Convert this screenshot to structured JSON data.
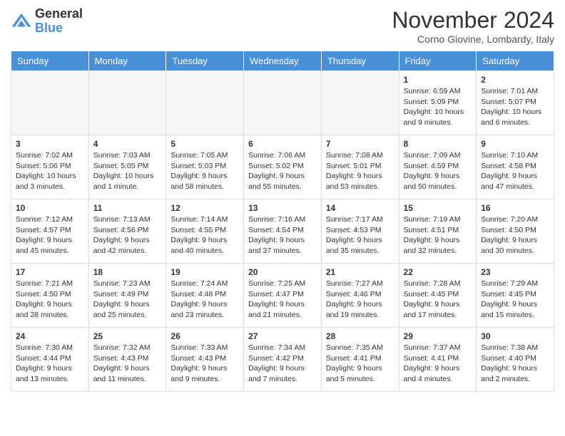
{
  "header": {
    "logo_general": "General",
    "logo_blue": "Blue",
    "month_title": "November 2024",
    "location": "Corno Giovine, Lombardy, Italy"
  },
  "days_of_week": [
    "Sunday",
    "Monday",
    "Tuesday",
    "Wednesday",
    "Thursday",
    "Friday",
    "Saturday"
  ],
  "weeks": [
    [
      {
        "day": "",
        "empty": true
      },
      {
        "day": "",
        "empty": true
      },
      {
        "day": "",
        "empty": true
      },
      {
        "day": "",
        "empty": true
      },
      {
        "day": "",
        "empty": true
      },
      {
        "day": "1",
        "sunrise": "Sunrise: 6:59 AM",
        "sunset": "Sunset: 5:09 PM",
        "daylight": "Daylight: 10 hours and 9 minutes."
      },
      {
        "day": "2",
        "sunrise": "Sunrise: 7:01 AM",
        "sunset": "Sunset: 5:07 PM",
        "daylight": "Daylight: 10 hours and 6 minutes."
      }
    ],
    [
      {
        "day": "3",
        "sunrise": "Sunrise: 7:02 AM",
        "sunset": "Sunset: 5:06 PM",
        "daylight": "Daylight: 10 hours and 3 minutes."
      },
      {
        "day": "4",
        "sunrise": "Sunrise: 7:03 AM",
        "sunset": "Sunset: 5:05 PM",
        "daylight": "Daylight: 10 hours and 1 minute."
      },
      {
        "day": "5",
        "sunrise": "Sunrise: 7:05 AM",
        "sunset": "Sunset: 5:03 PM",
        "daylight": "Daylight: 9 hours and 58 minutes."
      },
      {
        "day": "6",
        "sunrise": "Sunrise: 7:06 AM",
        "sunset": "Sunset: 5:02 PM",
        "daylight": "Daylight: 9 hours and 55 minutes."
      },
      {
        "day": "7",
        "sunrise": "Sunrise: 7:08 AM",
        "sunset": "Sunset: 5:01 PM",
        "daylight": "Daylight: 9 hours and 53 minutes."
      },
      {
        "day": "8",
        "sunrise": "Sunrise: 7:09 AM",
        "sunset": "Sunset: 4:59 PM",
        "daylight": "Daylight: 9 hours and 50 minutes."
      },
      {
        "day": "9",
        "sunrise": "Sunrise: 7:10 AM",
        "sunset": "Sunset: 4:58 PM",
        "daylight": "Daylight: 9 hours and 47 minutes."
      }
    ],
    [
      {
        "day": "10",
        "sunrise": "Sunrise: 7:12 AM",
        "sunset": "Sunset: 4:57 PM",
        "daylight": "Daylight: 9 hours and 45 minutes."
      },
      {
        "day": "11",
        "sunrise": "Sunrise: 7:13 AM",
        "sunset": "Sunset: 4:56 PM",
        "daylight": "Daylight: 9 hours and 42 minutes."
      },
      {
        "day": "12",
        "sunrise": "Sunrise: 7:14 AM",
        "sunset": "Sunset: 4:55 PM",
        "daylight": "Daylight: 9 hours and 40 minutes."
      },
      {
        "day": "13",
        "sunrise": "Sunrise: 7:16 AM",
        "sunset": "Sunset: 4:54 PM",
        "daylight": "Daylight: 9 hours and 37 minutes."
      },
      {
        "day": "14",
        "sunrise": "Sunrise: 7:17 AM",
        "sunset": "Sunset: 4:53 PM",
        "daylight": "Daylight: 9 hours and 35 minutes."
      },
      {
        "day": "15",
        "sunrise": "Sunrise: 7:19 AM",
        "sunset": "Sunset: 4:51 PM",
        "daylight": "Daylight: 9 hours and 32 minutes."
      },
      {
        "day": "16",
        "sunrise": "Sunrise: 7:20 AM",
        "sunset": "Sunset: 4:50 PM",
        "daylight": "Daylight: 9 hours and 30 minutes."
      }
    ],
    [
      {
        "day": "17",
        "sunrise": "Sunrise: 7:21 AM",
        "sunset": "Sunset: 4:50 PM",
        "daylight": "Daylight: 9 hours and 28 minutes."
      },
      {
        "day": "18",
        "sunrise": "Sunrise: 7:23 AM",
        "sunset": "Sunset: 4:49 PM",
        "daylight": "Daylight: 9 hours and 25 minutes."
      },
      {
        "day": "19",
        "sunrise": "Sunrise: 7:24 AM",
        "sunset": "Sunset: 4:48 PM",
        "daylight": "Daylight: 9 hours and 23 minutes."
      },
      {
        "day": "20",
        "sunrise": "Sunrise: 7:25 AM",
        "sunset": "Sunset: 4:47 PM",
        "daylight": "Daylight: 9 hours and 21 minutes."
      },
      {
        "day": "21",
        "sunrise": "Sunrise: 7:27 AM",
        "sunset": "Sunset: 4:46 PM",
        "daylight": "Daylight: 9 hours and 19 minutes."
      },
      {
        "day": "22",
        "sunrise": "Sunrise: 7:28 AM",
        "sunset": "Sunset: 4:45 PM",
        "daylight": "Daylight: 9 hours and 17 minutes."
      },
      {
        "day": "23",
        "sunrise": "Sunrise: 7:29 AM",
        "sunset": "Sunset: 4:45 PM",
        "daylight": "Daylight: 9 hours and 15 minutes."
      }
    ],
    [
      {
        "day": "24",
        "sunrise": "Sunrise: 7:30 AM",
        "sunset": "Sunset: 4:44 PM",
        "daylight": "Daylight: 9 hours and 13 minutes."
      },
      {
        "day": "25",
        "sunrise": "Sunrise: 7:32 AM",
        "sunset": "Sunset: 4:43 PM",
        "daylight": "Daylight: 9 hours and 11 minutes."
      },
      {
        "day": "26",
        "sunrise": "Sunrise: 7:33 AM",
        "sunset": "Sunset: 4:43 PM",
        "daylight": "Daylight: 9 hours and 9 minutes."
      },
      {
        "day": "27",
        "sunrise": "Sunrise: 7:34 AM",
        "sunset": "Sunset: 4:42 PM",
        "daylight": "Daylight: 9 hours and 7 minutes."
      },
      {
        "day": "28",
        "sunrise": "Sunrise: 7:35 AM",
        "sunset": "Sunset: 4:41 PM",
        "daylight": "Daylight: 9 hours and 5 minutes."
      },
      {
        "day": "29",
        "sunrise": "Sunrise: 7:37 AM",
        "sunset": "Sunset: 4:41 PM",
        "daylight": "Daylight: 9 hours and 4 minutes."
      },
      {
        "day": "30",
        "sunrise": "Sunrise: 7:38 AM",
        "sunset": "Sunset: 4:40 PM",
        "daylight": "Daylight: 9 hours and 2 minutes."
      }
    ]
  ]
}
